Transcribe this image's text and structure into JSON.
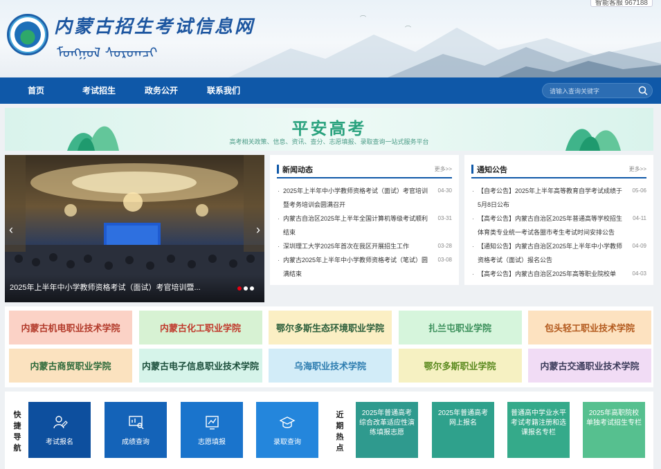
{
  "header": {
    "site_title": "内蒙古招生考试信息网",
    "mongolian_title": "ᠮᠣᠩᠭᠣᠯ ᠰᠤᠷᠤᠭᠴᠢ",
    "top_right": "智能客服 967188"
  },
  "nav": {
    "items": [
      "首页",
      "考试招生",
      "政务公开",
      "联系我们"
    ],
    "search_placeholder": "请输入查询关键字"
  },
  "banner": {
    "title": "平安高考",
    "subtitle": "高考相关政策、信息、资讯、查分、志愿填报、录取查询一站式服务平台"
  },
  "slider": {
    "caption": "2025年上半年中小学教师资格考试（面试）考官培训暨...",
    "dots": 3,
    "active_dot": 0
  },
  "news": {
    "title": "新闻动态",
    "more": "更多>>",
    "items": [
      {
        "text": "2025年上半年中小学教师资格考试（面试）考官培训暨考务培训会圆满召开",
        "date": "04-30"
      },
      {
        "text": "内蒙古自治区2025年上半年全国计算机等级考试顺利结束",
        "date": "03-31"
      },
      {
        "text": "深圳理工大学2025年首次在我区开展招生工作",
        "date": "03-28"
      },
      {
        "text": "内蒙古2025年上半年中小学教师资格考试（笔试）圆满结束",
        "date": "03-08"
      }
    ]
  },
  "notices": {
    "title": "通知公告",
    "more": "更多>>",
    "items": [
      {
        "text": "【自考公告】2025年上半年高等教育自学考试成绩于5月8日公布",
        "date": "05-06"
      },
      {
        "text": "【高考公告】内蒙古自治区2025年普通高等学校招生体育类专业统一考试各盟市考生考试时间安排公告",
        "date": "04-11"
      },
      {
        "text": "【通知公告】内蒙古自治区2025年上半年中小学教师资格考试（面试）报名公告",
        "date": "04-09"
      },
      {
        "text": "【高考公告】内蒙古自治区2025年高等职业院校单",
        "date": "04-03"
      }
    ]
  },
  "schools": [
    {
      "name": "内蒙古机电职业技术学院",
      "bg": "#fbd2c6",
      "color": "#b23a2a"
    },
    {
      "name": "内蒙古化工职业学院",
      "bg": "#d7f2d3",
      "color": "#c0392b"
    },
    {
      "name": "鄂尔多斯生态环境职业学院",
      "bg": "#fbefc4",
      "color": "#2b5e3a"
    },
    {
      "name": "扎兰屯职业学院",
      "bg": "#d6f5dc",
      "color": "#3a8f5a"
    },
    {
      "name": "包头轻工职业技术学院",
      "bg": "#fde2c0",
      "color": "#b35a1e"
    },
    {
      "name": "内蒙古商贸职业学院",
      "bg": "#fbe2bf",
      "color": "#2e6a3a"
    },
    {
      "name": "内蒙古电子信息职业技术学院",
      "bg": "#d6f4ea",
      "color": "#1b4e3b"
    },
    {
      "name": "乌海职业技术学院",
      "bg": "#d2ecf8",
      "color": "#2e7db0"
    },
    {
      "name": "鄂尔多斯职业学院",
      "bg": "#f6f1c2",
      "color": "#5b8a1f"
    },
    {
      "name": "内蒙古交通职业技术学院",
      "bg": "#f1dcf5",
      "color": "#3b3b5a"
    }
  ],
  "quick_nav": {
    "label": "快捷导航",
    "items": [
      {
        "label": "考试报名",
        "icon": "user-edit-icon",
        "color": "#0d4f9e"
      },
      {
        "label": "成绩查询",
        "icon": "chart-search-icon",
        "color": "#1463b8"
      },
      {
        "label": "志愿填报",
        "icon": "chart-board-icon",
        "color": "#1a74cc"
      },
      {
        "label": "录取查询",
        "icon": "graduation-cap-icon",
        "color": "#2486dc"
      }
    ]
  },
  "hot": {
    "label": "近期热点",
    "items": [
      {
        "label": "2025年普通高考综合改革适应性演练填报志愿",
        "color": "#2f9a8e"
      },
      {
        "label": "2025年普通高考网上报名",
        "color": "#2fa18c"
      },
      {
        "label": "普通高中学业水平考试考籍注册和选课报名专栏",
        "color": "#35aa8a"
      },
      {
        "label": "2025年高职院校单独考试招生专栏",
        "color": "#56c08f"
      }
    ]
  }
}
